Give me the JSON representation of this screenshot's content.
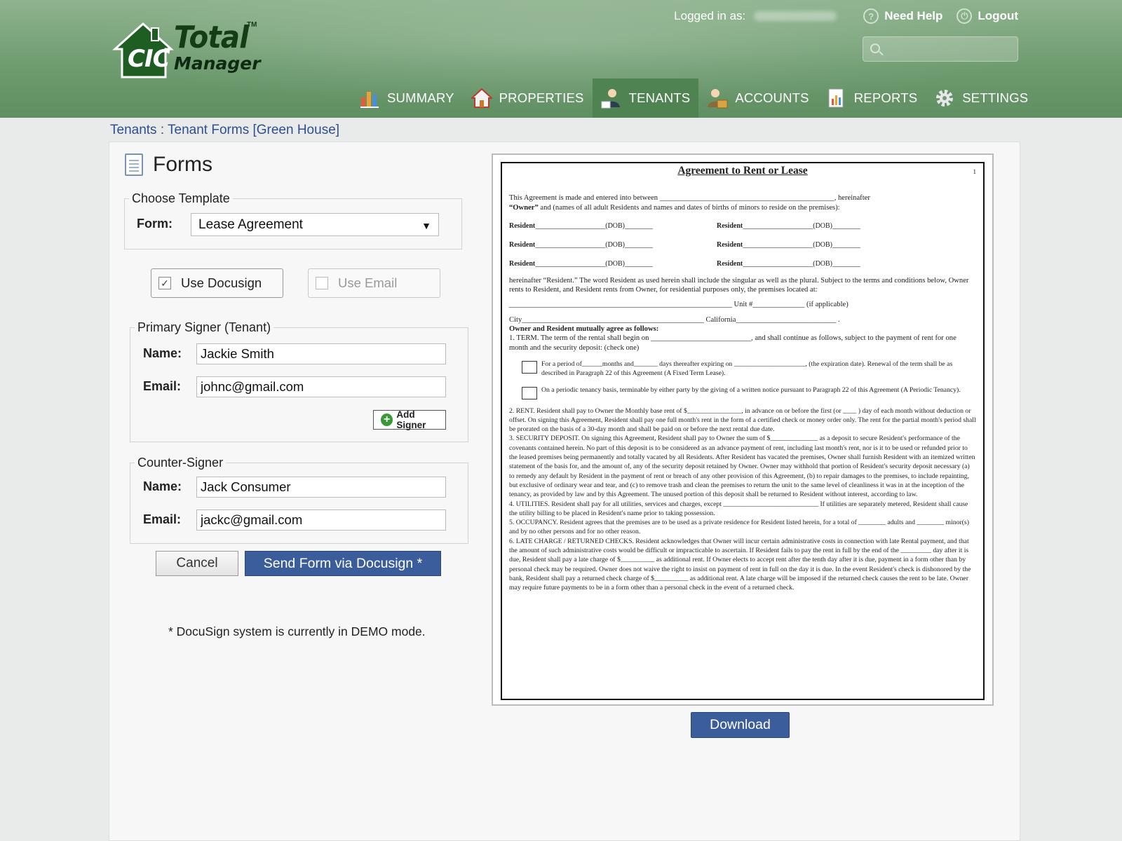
{
  "header": {
    "logo": {
      "cic": "CIC",
      "total": "Total",
      "tm": "TM",
      "manager": "Manager"
    },
    "logged_in_label": "Logged in as:",
    "need_help": "Need Help",
    "logout": "Logout",
    "search": {
      "placeholder": ""
    },
    "nav": [
      {
        "label": "SUMMARY",
        "icon": "bar-chart-icon"
      },
      {
        "label": "PROPERTIES",
        "icon": "house-icon"
      },
      {
        "label": "TENANTS",
        "icon": "tenants-icon",
        "active": true
      },
      {
        "label": "ACCOUNTS",
        "icon": "accounts-icon"
      },
      {
        "label": "REPORTS",
        "icon": "report-icon"
      },
      {
        "label": "SETTINGS",
        "icon": "gear-icon"
      }
    ]
  },
  "breadcrumb": "Tenants : Tenant Forms [Green House]",
  "forms": {
    "title": "Forms",
    "choose_template_legend": "Choose Template",
    "form_label": "Form:",
    "form_value": "Lease Agreement",
    "use_docusign": "Use Docusign",
    "use_email": "Use Email",
    "primary_legend": "Primary Signer (Tenant)",
    "counter_legend": "Counter-Signer",
    "name_label": "Name:",
    "email_label": "Email:",
    "primary_name": "Jackie Smith",
    "primary_email": "johnc@gmail.com",
    "add_signer": "Add Signer",
    "counter_name": "Jack Consumer",
    "counter_email": "jackc@gmail.com",
    "cancel": "Cancel",
    "send": "Send Form via Docusign *",
    "demo_note": "* DocuSign system is currently in DEMO mode."
  },
  "preview": {
    "title": "Agreement to Rent or Lease",
    "page_number": "1",
    "intro1": "This Agreement is made and entered into between _______________________________________________, hereinafter",
    "intro2_bold": "“Owner”",
    "intro2": " and (names of all adult Residents and names and dates of births of minors to reside on the premises):",
    "resident_label": "Resident",
    "dob_label": "(DOB)",
    "resident_line": "____________________",
    "dob_line": "________",
    "p_resident": "hereinafter “Resident.”  The word Resident as used herein shall include the singular as well as the plural.  Subject to the terms and conditions below, Owner rents to Resident, and Resident rents from Owner, for residential purposes only, the premises located at:",
    "p_unit": "____________________________________________________________ Unit #______________ (if applicable)",
    "p_city": "City_________________________________________________  California___________________________ .",
    "p_agree": "Owner and Resident mutually agree as follows:",
    "p_term": "1.  TERM.   The term of the rental shall begin on ___________________________, and shall continue as follows, subject to the payment of rent for one month and the security deposit: (check one)",
    "p_fixed": "For a period of______months and_______ days thereafter expiring on _____________________, (the expiration date).  Renewal of the term shall be as described in Paragraph 22 of this Agreement (A Fixed Term Lease).",
    "p_periodic": "On a periodic tenancy basis, terminable by either party by the giving of a written notice pursuant to Paragraph 22 of this Agreement (A Periodic Tenancy).",
    "p_rent": "2.  RENT.  Resident shall pay to Owner the Monthly base rent of  $________________, in advance on or before the first (or ____ ) day of each month without deduction or offset.  On signing this Agreement, Resident shall pay one full month's rent in the form of a certified check or money order only.  The rent for the partial month's period shall be prorated on the basis of a 30-day month and shall be paid on or before the next rental due date.",
    "p_deposit": "3. SECURITY DEPOSIT.  On signing this Agreement, Resident shall pay to Owner the sum of  $______________ as a deposit to secure Resident's performance of the covenants contained herein.  No part of this deposit is to be considered as an advance payment of rent, including last month's rent, nor is it to be used or refunded prior to the leased premises being permanently and totally vacated by all Residents.  After Resident has vacated the premises, Owner shall furnish  Resident with an itemized written statement of the basis for, and the amount of, any of the security deposit retained by  Owner.  Owner may withhold that portion of Resident's security deposit necessary (a) to remedy any default by Resident in the payment of rent or breach of any other provision of this Agreement, (b) to repair damages to the premises, to include repainting, but exclusive of ordinary wear and tear, and (c) to remove trash and clean the premises to return the unit to the same level of cleanliness it was in at the inception of the tenancy, as provided by law and by this Agreement.  The unused portion of this deposit shall be returned to Resident without interest, according to law.",
    "p_utilities": "4. UTILITIES.  Resident shall pay for all utilities, services and charges, except ____________________________ If utilities are separately metered, Resident shall cause the utility billing to be placed in Resident's name prior to taking possession.",
    "p_occupancy": "5.  OCCUPANCY.  Resident agrees that the premises are to be used as a private residence for Resident listed herein, for a total of ________ adults and ________ minor(s) and by no other persons and for no other reason.",
    "p_late": "6. LATE CHARGE / RETURNED CHECKS.  Resident acknowledges that Owner will incur certain administrative costs in connection with late Rental payment, and that the amount of such administrative costs would be difficult or impracticable to ascertain.  If Resident fails to pay the rent in full by the end of the _________ day after it is due, Resident shall pay a late charge of  $__________ as additional rent.  If Owner elects to accept rent after the tenth day after it is due, payment in a form other than by personal check may be required.  Owner does not waive the right to insist on payment of rent in full on the day it is due.  In the event Resident's check is dishonored by the bank, Resident shall pay a returned check charge of $__________ as additional rent.  A late charge will be imposed if the returned check causes the rent to be late.  Owner may require future payments to be in a form other than a personal check in the event of a returned check.",
    "download": "Download"
  }
}
